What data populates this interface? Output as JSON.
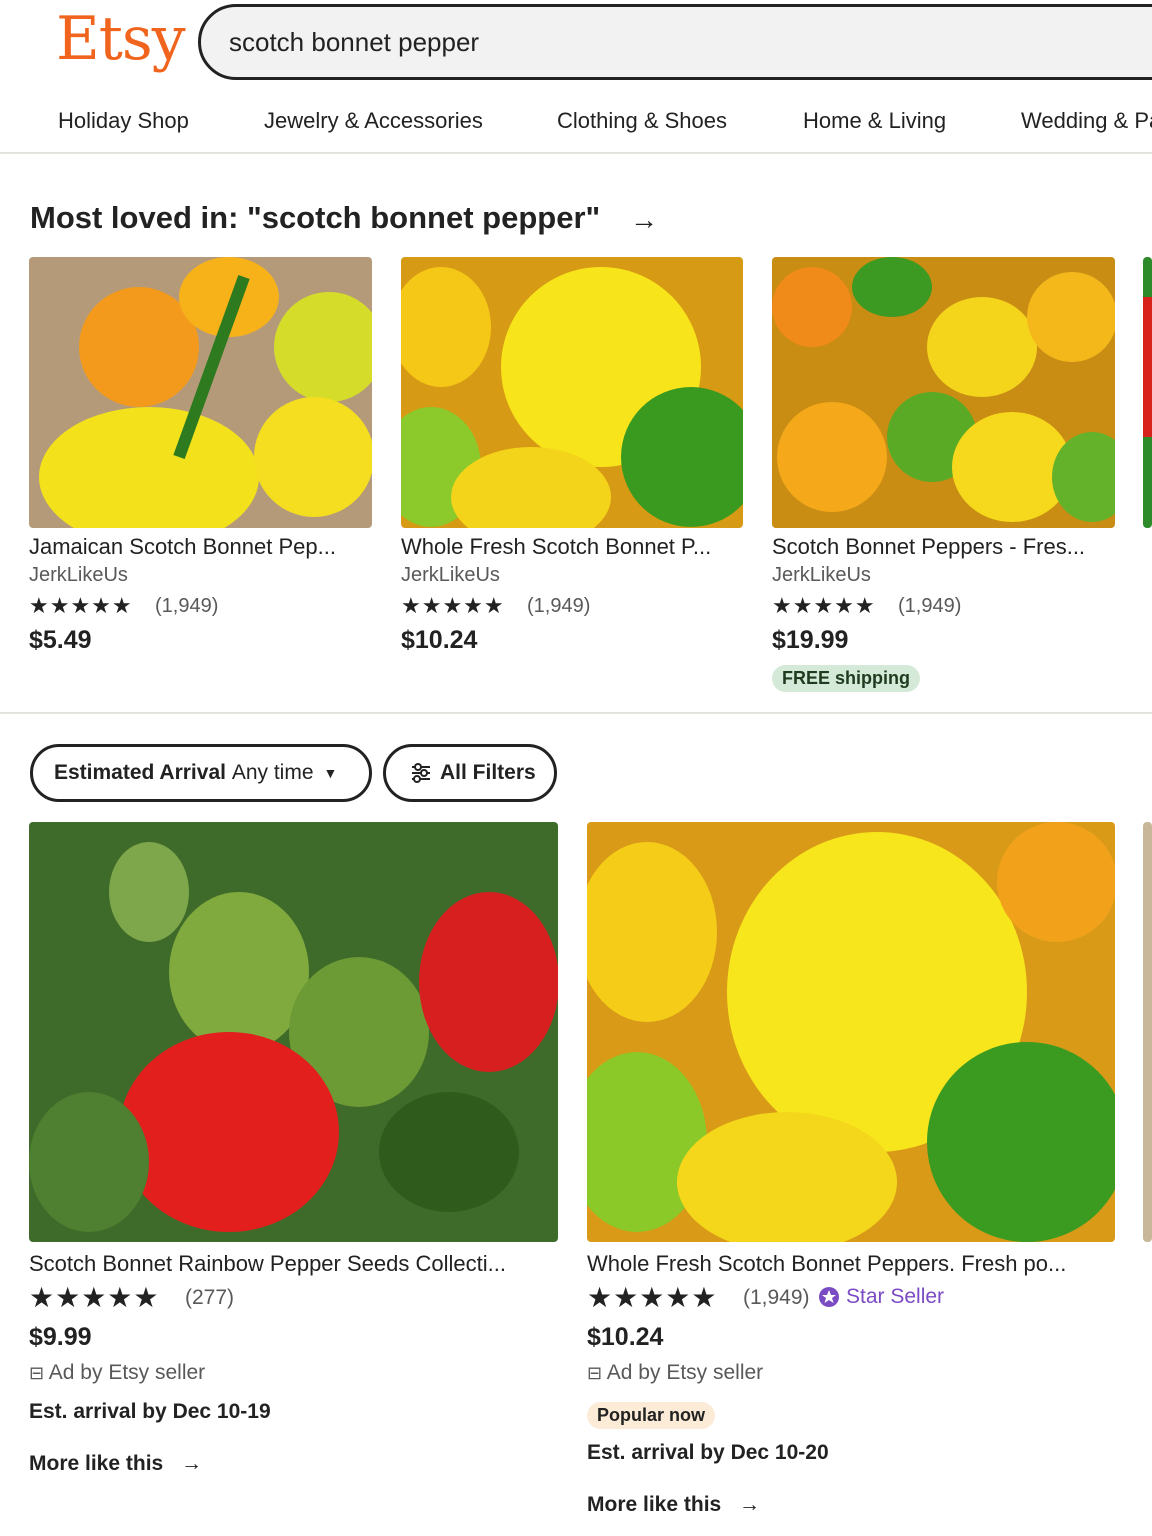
{
  "header": {
    "logo": "Etsy",
    "search_value": "scotch bonnet pepper",
    "brand_color": "#f1641e"
  },
  "nav": {
    "items": [
      "Holiday Shop",
      "Jewelry & Accessories",
      "Clothing & Shoes",
      "Home & Living",
      "Wedding & Pa"
    ]
  },
  "most_loved": {
    "title": "Most loved in: \"scotch bonnet pepper\"",
    "arrow": "→",
    "items": [
      {
        "title": "Jamaican Scotch Bonnet Pep...",
        "shop": "JerkLikeUs",
        "stars": "★★★★★",
        "count": "(1,949)",
        "price": "$5.49"
      },
      {
        "title": "Whole Fresh Scotch Bonnet P...",
        "shop": "JerkLikeUs",
        "stars": "★★★★★",
        "count": "(1,949)",
        "price": "$10.24"
      },
      {
        "title": "Scotch Bonnet Peppers - Fres...",
        "shop": "JerkLikeUs",
        "stars": "★★★★★",
        "count": "(1,949)",
        "price": "$19.99",
        "badge": "FREE shipping"
      }
    ]
  },
  "filters": {
    "arrival_label": "Estimated Arrival",
    "arrival_value": "Any time",
    "all_filters": "All Filters"
  },
  "listings": [
    {
      "title": "Scotch Bonnet Rainbow Pepper Seeds Collecti...",
      "stars": "★★★★★",
      "count": "(277)",
      "price": "$9.99",
      "ad": "Ad by Etsy seller",
      "arrival": "Est. arrival by Dec 10-19",
      "more": "More like this"
    },
    {
      "title": "Whole Fresh Scotch Bonnet Peppers. Fresh po...",
      "stars": "★★★★★",
      "count": "(1,949)",
      "star_seller": "Star Seller",
      "price": "$10.24",
      "ad": "Ad by Etsy seller",
      "badge": "Popular now",
      "arrival": "Est. arrival by Dec 10-20",
      "more": "More like this"
    }
  ]
}
